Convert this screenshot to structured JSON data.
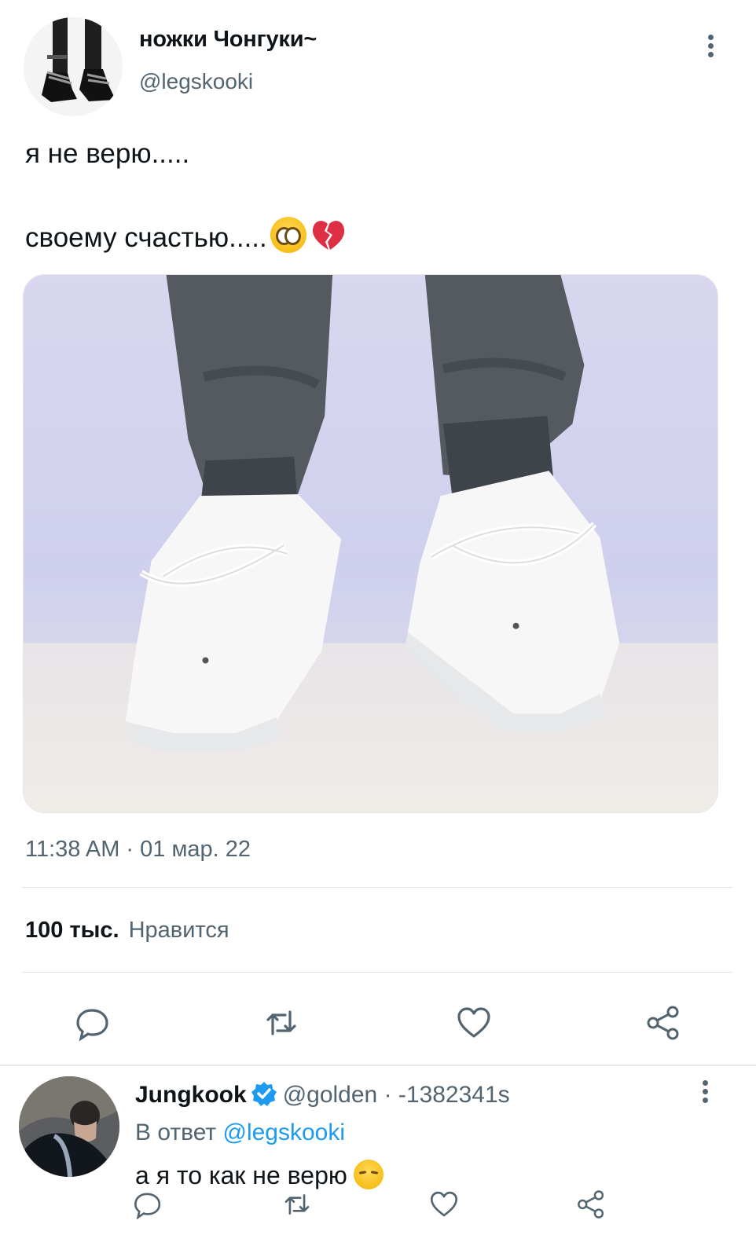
{
  "tweet": {
    "author": {
      "display_name": "ножки Чонгуки~",
      "handle": "@legskooki",
      "avatar": "black-boots-icon"
    },
    "text_lines": [
      "я не верю.....",
      "своему счастью....."
    ],
    "emoji": [
      "pleading-face-icon",
      "broken-heart-icon"
    ],
    "media": {
      "description_icon": "photo-icon"
    },
    "timestamp": "11:38 AM · 01 мар. 22",
    "likes_count": "100 тыс.",
    "likes_label": "Нравится",
    "actions": [
      "reply-icon",
      "retweet-icon",
      "like-icon",
      "share-icon"
    ]
  },
  "reply": {
    "display_name": "Jungkook",
    "verified": true,
    "handle_time": "@golden · -1382341s",
    "reply_to_prefix": "В ответ",
    "reply_to_handle": "@legskooki",
    "text": "а я то как не верю",
    "emoji": "pensive-face-icon",
    "actions": [
      "reply-icon",
      "retweet-icon",
      "like-icon",
      "share-icon"
    ]
  },
  "colors": {
    "text_primary": "#0f1419",
    "text_secondary": "#536471",
    "link": "#1d9bf0",
    "divider": "#dfe3e6"
  }
}
